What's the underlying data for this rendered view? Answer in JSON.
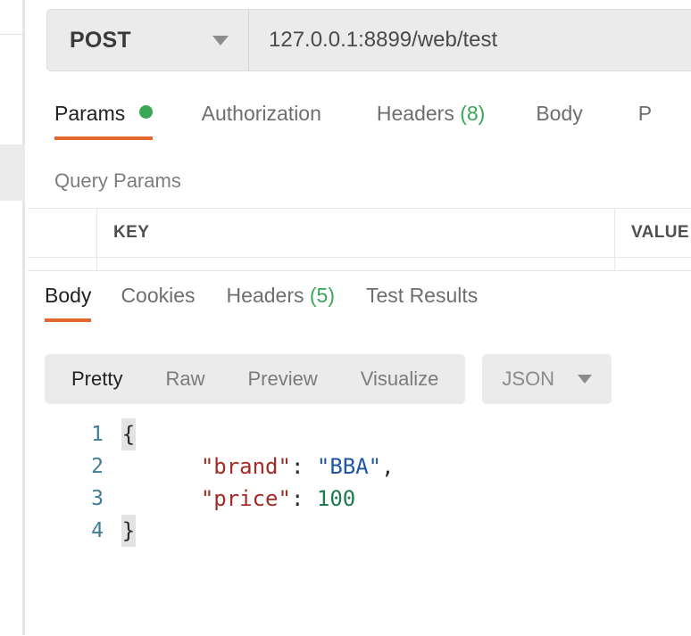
{
  "request_bar": {
    "method": "POST",
    "method_caret": "chevron-down-icon",
    "url": "127.0.0.1:8899/web/test"
  },
  "request_tabs": [
    {
      "label": "Params",
      "badge": "",
      "indicator": "green-dot",
      "active": true
    },
    {
      "label": "Authorization",
      "badge": "",
      "indicator": "",
      "active": false
    },
    {
      "label": "Headers",
      "badge": "(8)",
      "indicator": "",
      "active": false
    },
    {
      "label": "Body",
      "badge": "",
      "indicator": "",
      "active": false
    },
    {
      "label": "P",
      "badge": "",
      "indicator": "",
      "active": false
    }
  ],
  "query_params": {
    "title": "Query Params",
    "columns": [
      "",
      "KEY",
      "VALUE"
    ],
    "rows": []
  },
  "response_tabs": [
    {
      "label": "Body",
      "badge": "",
      "active": true
    },
    {
      "label": "Cookies",
      "badge": "",
      "active": false
    },
    {
      "label": "Headers",
      "badge": "(5)",
      "active": false
    },
    {
      "label": "Test Results",
      "badge": "",
      "active": false
    }
  ],
  "format_bar": {
    "options": [
      {
        "label": "Pretty",
        "active": true
      },
      {
        "label": "Raw",
        "active": false
      },
      {
        "label": "Preview",
        "active": false
      },
      {
        "label": "Visualize",
        "active": false
      }
    ],
    "language": "JSON",
    "language_caret": "chevron-down-icon"
  },
  "response_body": {
    "language": "json",
    "lines": [
      {
        "number": "1",
        "fold": "{",
        "text": ""
      },
      {
        "number": "2",
        "fold": "",
        "text": "    \"brand\": \"BBA\","
      },
      {
        "number": "3",
        "fold": "",
        "text": "    \"price\": 100"
      },
      {
        "number": "4",
        "fold": "}",
        "text": ""
      }
    ],
    "raw": "{\n    \"brand\": \"BBA\",\n    \"price\": 100\n}"
  },
  "colors": {
    "accent": "#e3682f",
    "success": "#3aa757",
    "panel": "#ebebeb",
    "json_key": "#a22b25",
    "json_string": "#2254a4",
    "json_number": "#1f7a4d",
    "line_number": "#3f7e96"
  }
}
